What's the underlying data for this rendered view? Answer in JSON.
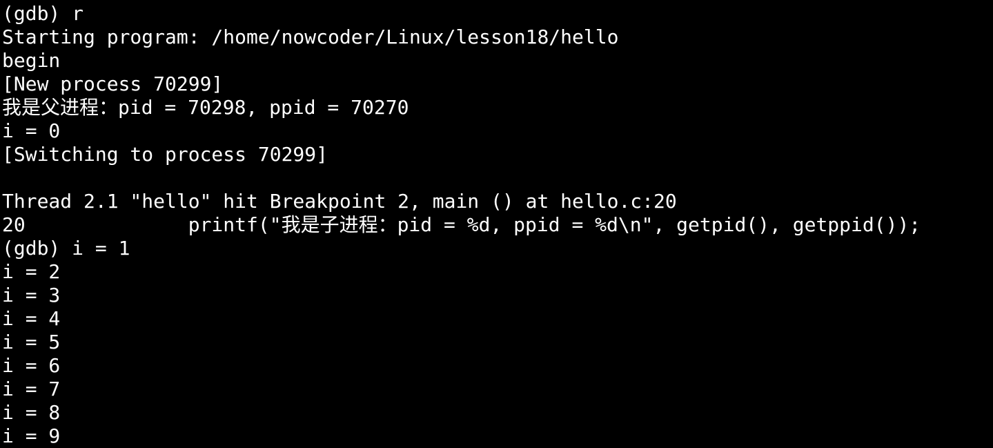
{
  "terminal": {
    "lines": [
      "(gdb) r",
      "Starting program: /home/nowcoder/Linux/lesson18/hello",
      "begin",
      "[New process 70299]",
      "我是父进程：pid = 70298, ppid = 70270",
      "i = 0",
      "[Switching to process 70299]",
      "",
      "Thread 2.1 \"hello\" hit Breakpoint 2, main () at hello.c:20",
      "20              printf(\"我是子进程：pid = %d, ppid = %d\\n\", getpid(), getppid());",
      "(gdb) i = 1",
      "i = 2",
      "i = 3",
      "i = 4",
      "i = 5",
      "i = 6",
      "i = 7",
      "i = 8",
      "i = 9"
    ]
  },
  "colors": {
    "background": "#000000",
    "foreground": "#ffffff"
  }
}
